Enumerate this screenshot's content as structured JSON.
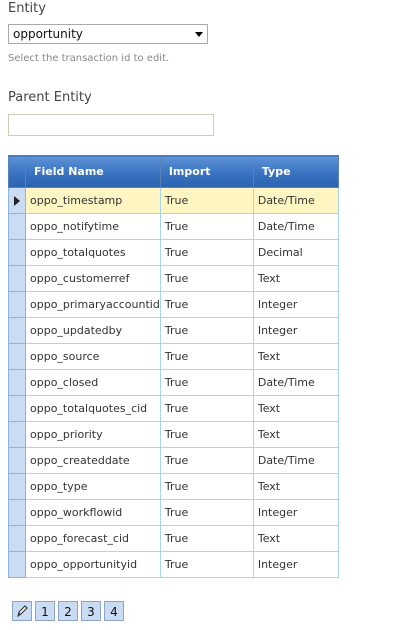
{
  "entity": {
    "label": "Entity",
    "selected": "opportunity",
    "hint": "Select the transaction id to edit."
  },
  "parent_entity": {
    "label": "Parent Entity",
    "value": ""
  },
  "grid": {
    "columns": [
      "Field Name",
      "Import",
      "Type"
    ],
    "rows": [
      {
        "field": "oppo_timestamp",
        "import": "True",
        "type": "Date/Time"
      },
      {
        "field": "oppo_notifytime",
        "import": "True",
        "type": "Date/Time"
      },
      {
        "field": "oppo_totalquotes",
        "import": "True",
        "type": "Decimal"
      },
      {
        "field": "oppo_customerref",
        "import": "True",
        "type": "Text"
      },
      {
        "field": "oppo_primaryaccountid",
        "import": "True",
        "type": "Integer"
      },
      {
        "field": "oppo_updatedby",
        "import": "True",
        "type": "Integer"
      },
      {
        "field": "oppo_source",
        "import": "True",
        "type": "Text"
      },
      {
        "field": "oppo_closed",
        "import": "True",
        "type": "Date/Time"
      },
      {
        "field": "oppo_totalquotes_cid",
        "import": "True",
        "type": "Text"
      },
      {
        "field": "oppo_priority",
        "import": "True",
        "type": "Text"
      },
      {
        "field": "oppo_createddate",
        "import": "True",
        "type": "Date/Time"
      },
      {
        "field": "oppo_type",
        "import": "True",
        "type": "Text"
      },
      {
        "field": "oppo_workflowid",
        "import": "True",
        "type": "Integer"
      },
      {
        "field": "oppo_forecast_cid",
        "import": "True",
        "type": "Text"
      },
      {
        "field": "oppo_opportunityid",
        "import": "True",
        "type": "Integer"
      }
    ]
  },
  "pager": {
    "edit_icon": "pencil-icon",
    "pages": [
      "1",
      "2",
      "3",
      "4"
    ]
  }
}
